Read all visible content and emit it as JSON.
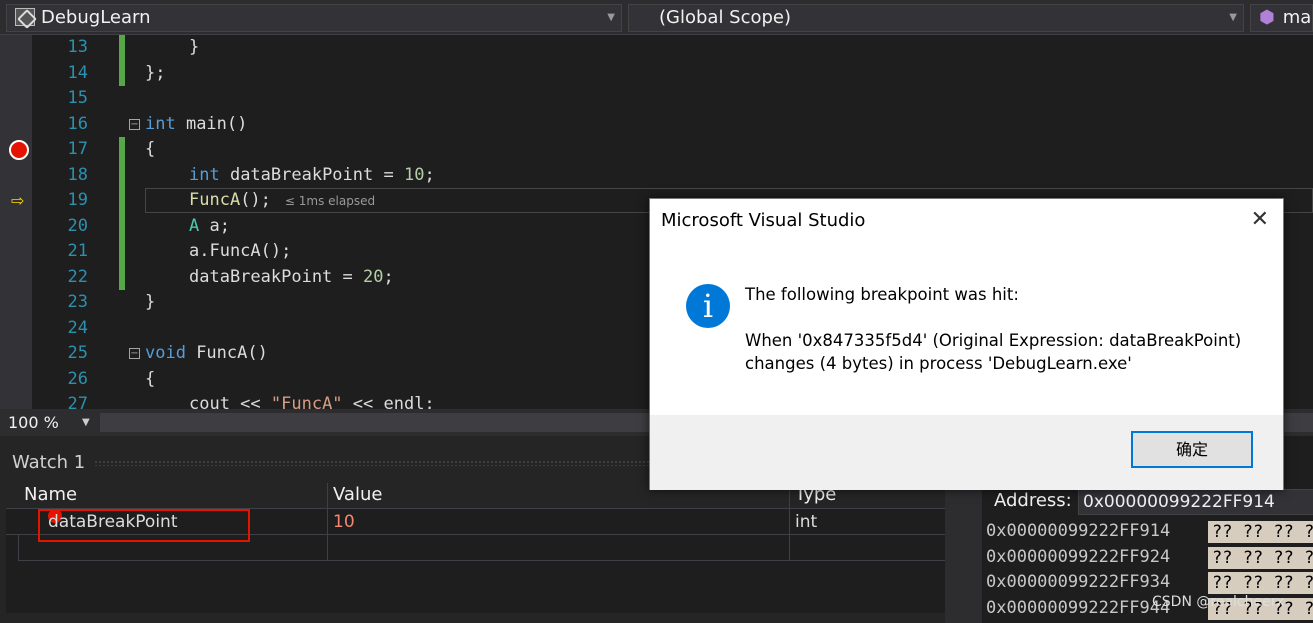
{
  "nav": {
    "project": "DebugLearn",
    "scope": "(Global Scope)",
    "member": "mai"
  },
  "code_lines": [
    {
      "num": "13",
      "text": "}"
    },
    {
      "num": "14",
      "text": "};"
    },
    {
      "num": "15",
      "text": ""
    },
    {
      "num": "16",
      "kw": "int",
      "rest": " main()"
    },
    {
      "num": "17",
      "text": "{"
    },
    {
      "num": "18",
      "kw": "int",
      "mid": " dataBreakPoint = ",
      "n": "10",
      "end": ";"
    },
    {
      "num": "19",
      "fn": "FuncA",
      "rest": "();",
      "hint": "≤ 1ms elapsed"
    },
    {
      "num": "20",
      "ty": "A",
      "rest": " a;"
    },
    {
      "num": "21",
      "text": "a.FuncA();"
    },
    {
      "num": "22",
      "mid": "dataBreakPoint = ",
      "n": "20",
      "end": ";"
    },
    {
      "num": "23",
      "text": "}"
    },
    {
      "num": "24",
      "text": ""
    },
    {
      "num": "25",
      "kw": "void",
      "rest": " FuncA()"
    },
    {
      "num": "26",
      "text": "{"
    },
    {
      "num": "27",
      "mid": "cout << ",
      "s": "\"FuncA\"",
      "end": " << endl;"
    }
  ],
  "zoom": {
    "level": "100 %"
  },
  "watch": {
    "title": "Watch 1",
    "columns": [
      "Name",
      "Value",
      "Type"
    ],
    "rows": [
      {
        "name": "dataBreakPoint",
        "value": "10",
        "type": "int"
      }
    ]
  },
  "memory": {
    "address_label": "Address:",
    "address_value": "0x00000099222FF914",
    "rows": [
      {
        "addr": "0x00000099222FF914",
        "bytes": "?? ?? ?? ??"
      },
      {
        "addr": "0x00000099222FF924",
        "bytes": "?? ?? ?? ??"
      },
      {
        "addr": "0x00000099222FF934",
        "bytes": "?? ?? ?? ??"
      },
      {
        "addr": "0x00000099222FF944",
        "bytes": "?? ?? ?? ??"
      }
    ]
  },
  "watermark": "CSDN @realcheerx",
  "dialog": {
    "title": "Microsoft Visual Studio",
    "icon": "i",
    "line1": "The following breakpoint was hit:",
    "line2": "When '0x847335f5d4' (Original Expression: dataBreakPoint)",
    "line3": "changes (4 bytes) in process 'DebugLearn.exe'",
    "ok": "确定"
  },
  "colors": {
    "breakpoint": "#e51400",
    "accent": "#0078d7",
    "keyword": "#569cd6",
    "type": "#4ec9b0",
    "number": "#b5cea8"
  }
}
